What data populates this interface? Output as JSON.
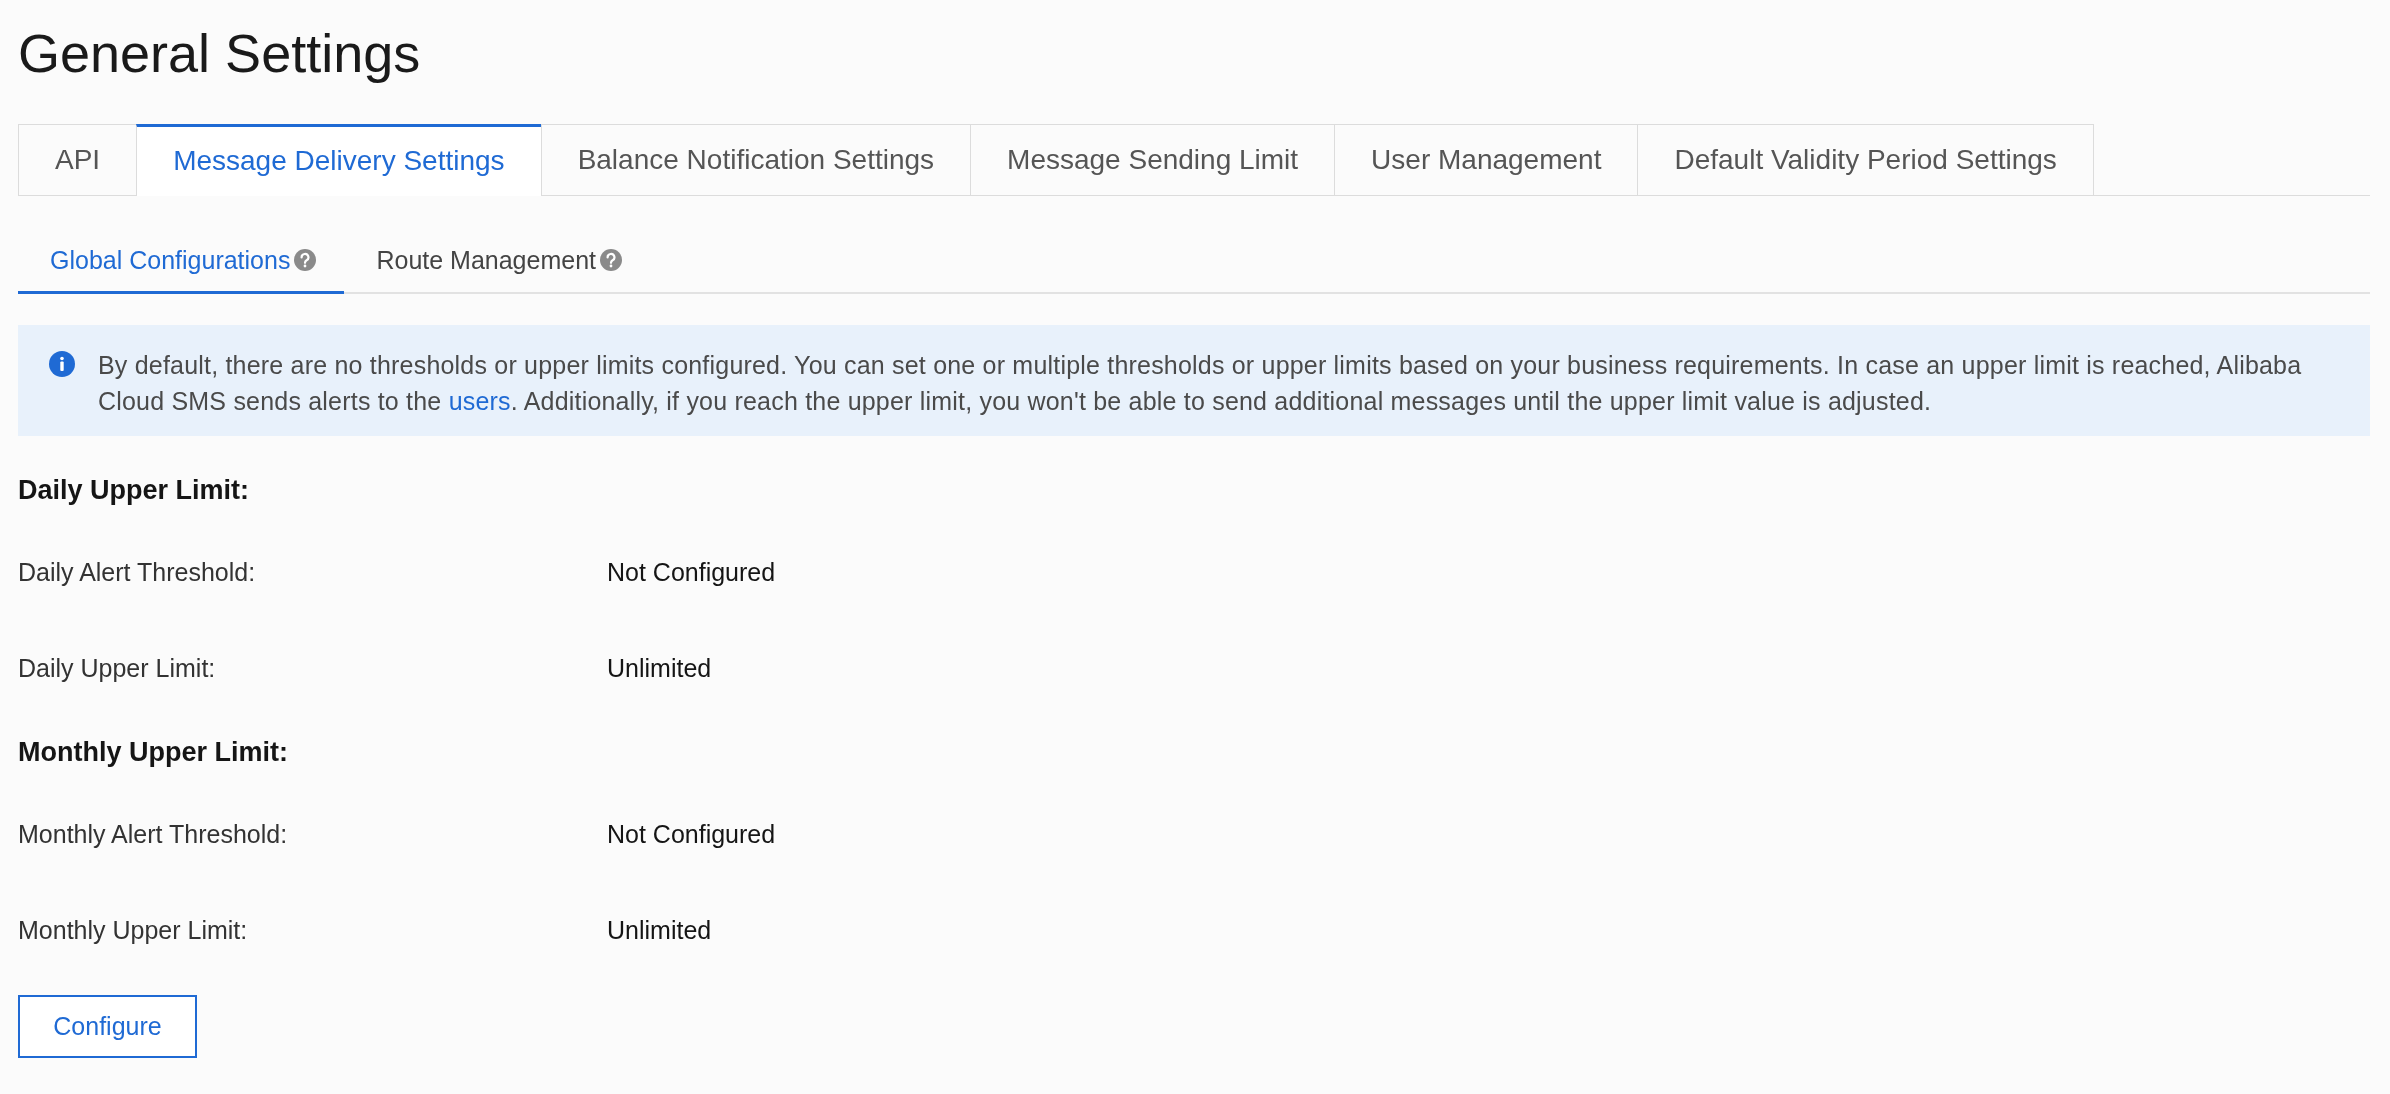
{
  "page": {
    "title": "General Settings"
  },
  "tabs": [
    {
      "label": "API",
      "selected": false
    },
    {
      "label": "Message Delivery Settings",
      "selected": true
    },
    {
      "label": "Balance Notification Settings",
      "selected": false
    },
    {
      "label": "Message Sending Limit",
      "selected": false
    },
    {
      "label": "User Management",
      "selected": false
    },
    {
      "label": "Default Validity Period Settings",
      "selected": false
    }
  ],
  "subtabs": [
    {
      "label": "Global Configurations",
      "selected": true,
      "help": true
    },
    {
      "label": "Route Management",
      "selected": false,
      "help": true
    }
  ],
  "notice": {
    "text_before": "By default, there are no thresholds or upper limits configured. You can set one or multiple thresholds or upper limits based on your business requirements. In case an upper limit is reached, Alibaba Cloud SMS sends alerts to the ",
    "link": "users",
    "text_after": ". Additionally, if you reach the upper limit, you won't be able to send additional messages until the upper limit value is adjusted."
  },
  "sections": [
    {
      "heading": "Daily Upper Limit:",
      "rows": [
        {
          "label": "Daily Alert Threshold:",
          "value": "Not Configured"
        },
        {
          "label": "Daily Upper Limit:",
          "value": "Unlimited"
        }
      ]
    },
    {
      "heading": "Monthly Upper Limit:",
      "rows": [
        {
          "label": "Monthly Alert Threshold:",
          "value": "Not Configured"
        },
        {
          "label": "Monthly Upper Limit:",
          "value": "Unlimited"
        }
      ]
    }
  ],
  "button": {
    "label": "Configure"
  }
}
